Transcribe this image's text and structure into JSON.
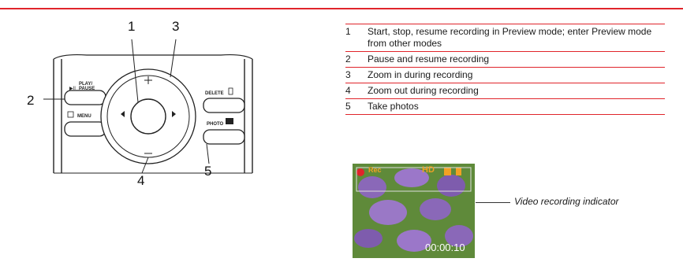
{
  "heading": "",
  "callouts": [
    "1",
    "2",
    "3",
    "4",
    "5"
  ],
  "diagram": {
    "play_pause_label": "PLAY/\nPAUSE",
    "menu_label": "MENU",
    "delete_label": "DELETE",
    "photo_label": "PHOTO"
  },
  "table": [
    {
      "num": "1",
      "desc": "Start, stop, resume recording in Preview mode; enter Preview mode from other modes"
    },
    {
      "num": "2",
      "desc": "Pause and resume recording"
    },
    {
      "num": "3",
      "desc": "Zoom in during recording"
    },
    {
      "num": "4",
      "desc": "Zoom out during recording"
    },
    {
      "num": "5",
      "desc": "Take photos"
    }
  ],
  "screen": {
    "rec_label": "Rec",
    "hd_label": "HD",
    "timecode": "00:00:10"
  },
  "annotation": "Video recording indicator"
}
